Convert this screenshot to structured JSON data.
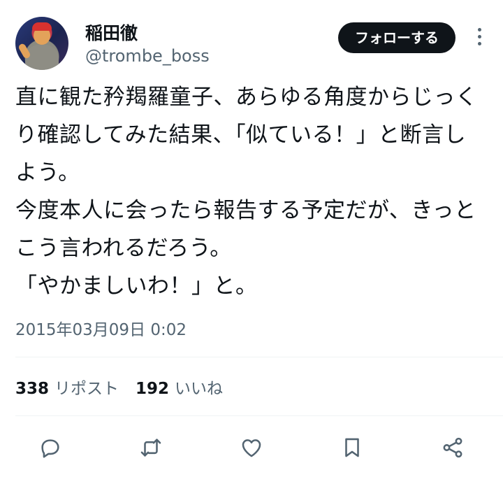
{
  "author": {
    "name": "稲田徹",
    "handle": "@trombe_boss"
  },
  "follow_label": "フォローする",
  "tweet": {
    "text": "直に観た矜羯羅童子、あらゆる角度からじっくり確認してみた結果、「似ている！」と断言しよう。\n今度本人に会ったら報告する予定だが、きっとこう言われるだろう。\n「やかましいわ！」と。",
    "timestamp": "2015年03月09日 0:02"
  },
  "stats": {
    "reposts_count": "338",
    "reposts_label": "リポスト",
    "likes_count": "192",
    "likes_label": "いいね"
  },
  "icons": {
    "more": "more-vertical-icon",
    "reply": "reply-icon",
    "repost": "repost-icon",
    "like": "heart-icon",
    "bookmark": "bookmark-icon",
    "share": "share-icon"
  },
  "colors": {
    "text": "#0f1419",
    "muted": "#536471",
    "button_bg": "#0f1419",
    "button_text": "#ffffff",
    "divider": "#eff3f4"
  }
}
